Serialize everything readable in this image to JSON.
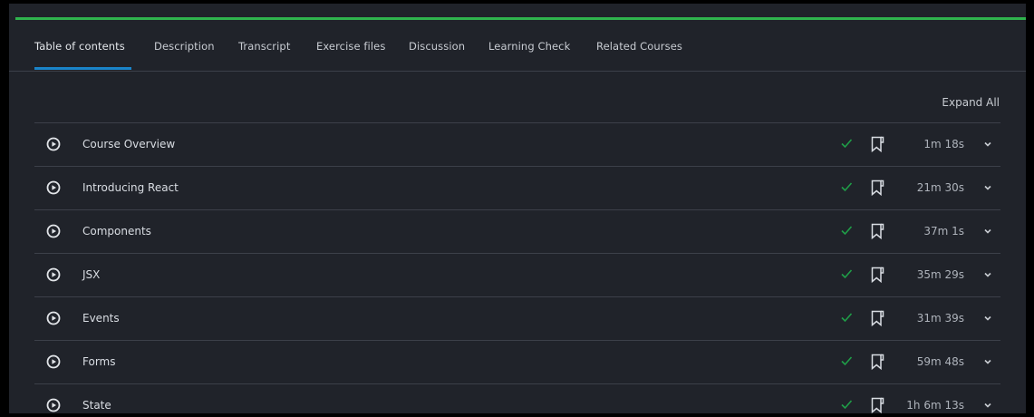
{
  "colors": {
    "accent_green": "#2fb34d",
    "tab_underline": "#1a84c9",
    "check_green": "#1f9e48",
    "panel_bg": "#20232a",
    "divider": "#3c4049"
  },
  "tabs": [
    {
      "label": "Table of contents",
      "active": true
    },
    {
      "label": "Description",
      "active": false
    },
    {
      "label": "Transcript",
      "active": false
    },
    {
      "label": "Exercise files",
      "active": false
    },
    {
      "label": "Discussion",
      "active": false
    },
    {
      "label": "Learning Check",
      "active": false
    },
    {
      "label": "Related Courses",
      "active": false
    }
  ],
  "toc": {
    "expand_all_label": "Expand All",
    "modules": [
      {
        "title": "Course Overview",
        "duration": "1m 18s",
        "completed": true,
        "icon": "play-circle-icon"
      },
      {
        "title": "Introducing React",
        "duration": "21m 30s",
        "completed": true,
        "icon": "play-circle-icon"
      },
      {
        "title": "Components",
        "duration": "37m 1s",
        "completed": true,
        "icon": "play-circle-icon"
      },
      {
        "title": "JSX",
        "duration": "35m 29s",
        "completed": true,
        "icon": "play-circle-icon"
      },
      {
        "title": "Events",
        "duration": "31m 39s",
        "completed": true,
        "icon": "play-circle-icon"
      },
      {
        "title": "Forms",
        "duration": "59m 48s",
        "completed": true,
        "icon": "play-circle-icon"
      },
      {
        "title": "State",
        "duration": "1h 6m 13s",
        "completed": true,
        "icon": "play-circle-icon"
      }
    ]
  }
}
